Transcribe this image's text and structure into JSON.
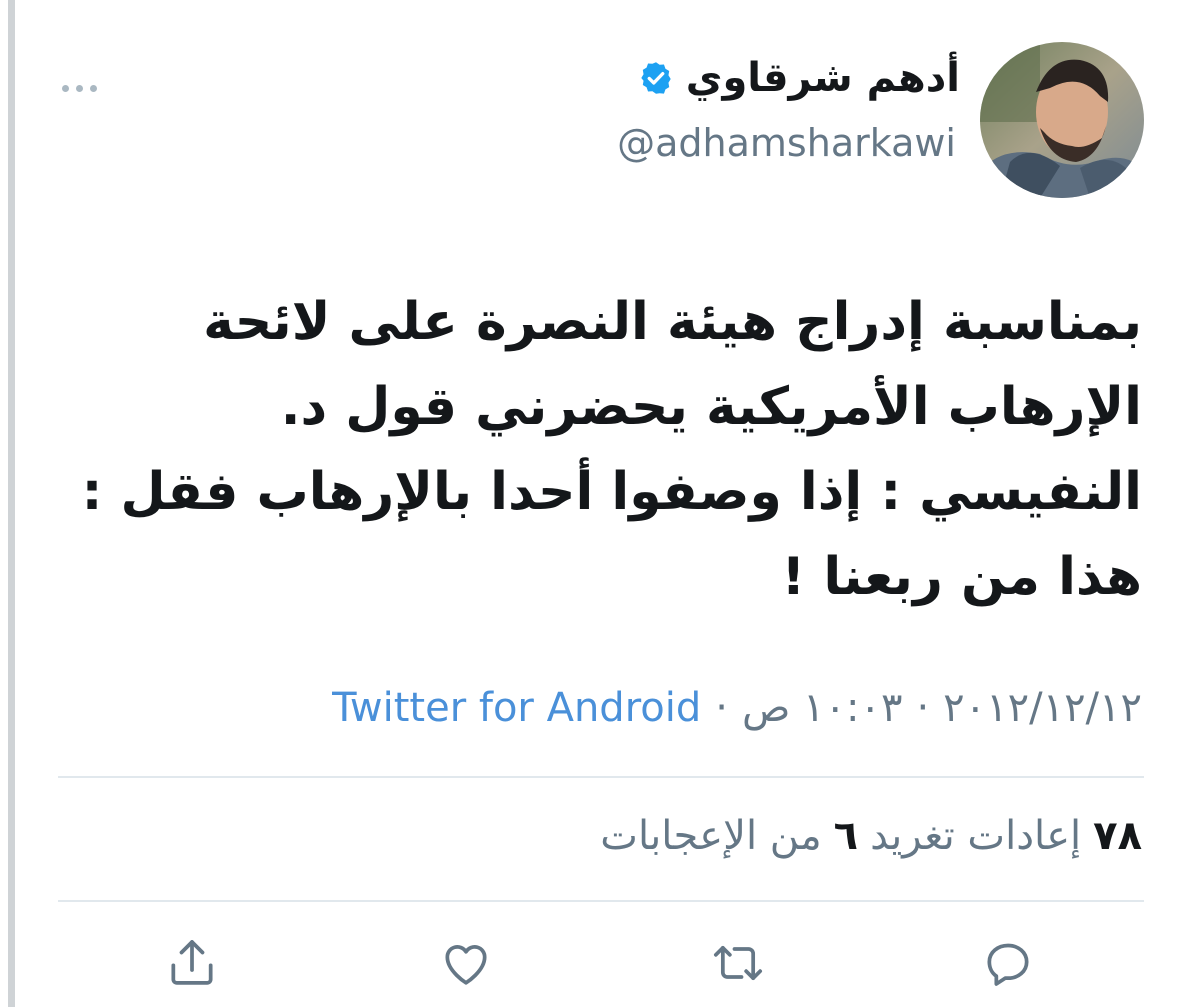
{
  "tweet": {
    "author": {
      "display_name": "أدهم شرقاوي",
      "handle": "@adhamsharkawi",
      "verified_icon": "verified-badge-icon"
    },
    "text_lines": [
      "بمناسبة إدراج هيئة النصرة على لائحة",
      "الإرهاب الأمريكية يحضرني قول د.",
      "النفيسي : إذا وصفوا أحدا بالإرهاب فقل :",
      "هذا من ربعنا !"
    ],
    "meta": {
      "date": "٢٠١٢/١٢/١٢",
      "separator": "·",
      "time": "١٠:٠٣ ص",
      "source": "Twitter for Android"
    },
    "stats": {
      "retweets_count": "٧٨",
      "retweets_label": "إعادات تغريد",
      "likes_count": "٦",
      "likes_label": "من الإعجابات"
    },
    "actions": [
      "reply-icon",
      "retweet-icon",
      "like-icon",
      "share-icon"
    ],
    "menu_icon": "more-options-icon"
  },
  "colors": {
    "text": "#14171a",
    "secondary": "#657786",
    "link": "#4a90d9",
    "verified": "#1da1f2",
    "divider": "#e1e8ed"
  }
}
